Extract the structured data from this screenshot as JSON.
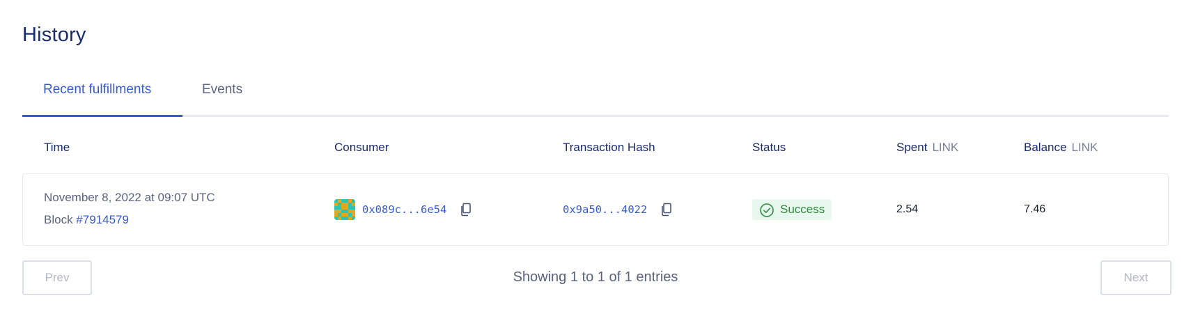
{
  "page": {
    "title": "History"
  },
  "tabs": [
    {
      "label": "Recent fulfillments",
      "active": true
    },
    {
      "label": "Events",
      "active": false
    }
  ],
  "table": {
    "columns": [
      {
        "label": "Time",
        "unit": ""
      },
      {
        "label": "Consumer",
        "unit": ""
      },
      {
        "label": "Transaction Hash",
        "unit": ""
      },
      {
        "label": "Status",
        "unit": ""
      },
      {
        "label": "Spent",
        "unit": "LINK"
      },
      {
        "label": "Balance",
        "unit": "LINK"
      }
    ],
    "rows": [
      {
        "time": "November 8, 2022 at 09:07 UTC",
        "block_label": "Block ",
        "block_number": "#7914579",
        "consumer": "0x089c...6e54",
        "tx_hash": "0x9a50...4022",
        "status": "Success",
        "spent": "2.54",
        "balance": "7.46"
      }
    ]
  },
  "pagination": {
    "prev_label": "Prev",
    "next_label": "Next",
    "info": "Showing 1 to 1 of 1 entries"
  },
  "colors": {
    "accent": "#375bd2",
    "heading": "#1a2b6b",
    "success": "#2e8b3e",
    "success_bg": "#e9f8ee"
  },
  "icons": {
    "copy": "copy-icon",
    "status": "check-circle-icon",
    "avatar": "identicon"
  }
}
